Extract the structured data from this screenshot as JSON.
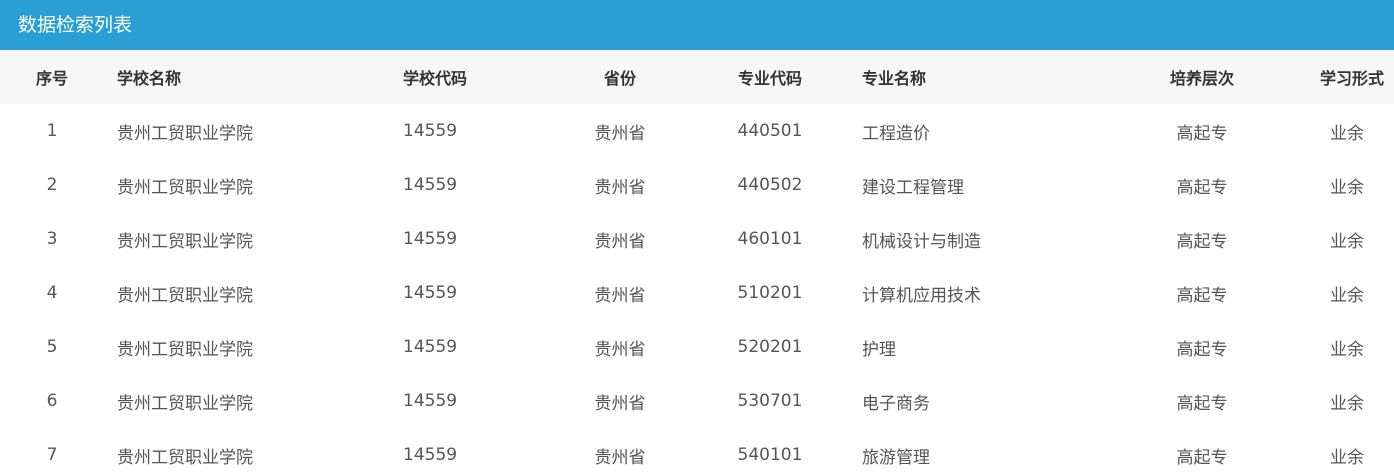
{
  "panel": {
    "title": "数据检索列表"
  },
  "table": {
    "headers": {
      "index": "序号",
      "school_name": "学校名称",
      "school_code": "学校代码",
      "province": "省份",
      "major_code": "专业代码",
      "major_name": "专业名称",
      "level": "培养层次",
      "study_form": "学习形式"
    },
    "rows": [
      {
        "index": "1",
        "school_name": "贵州工贸职业学院",
        "school_code": "14559",
        "province": "贵州省",
        "major_code": "440501",
        "major_name": "工程造价",
        "level": "高起专",
        "study_form": "业余"
      },
      {
        "index": "2",
        "school_name": "贵州工贸职业学院",
        "school_code": "14559",
        "province": "贵州省",
        "major_code": "440502",
        "major_name": "建设工程管理",
        "level": "高起专",
        "study_form": "业余"
      },
      {
        "index": "3",
        "school_name": "贵州工贸职业学院",
        "school_code": "14559",
        "province": "贵州省",
        "major_code": "460101",
        "major_name": "机械设计与制造",
        "level": "高起专",
        "study_form": "业余"
      },
      {
        "index": "4",
        "school_name": "贵州工贸职业学院",
        "school_code": "14559",
        "province": "贵州省",
        "major_code": "510201",
        "major_name": "计算机应用技术",
        "level": "高起专",
        "study_form": "业余"
      },
      {
        "index": "5",
        "school_name": "贵州工贸职业学院",
        "school_code": "14559",
        "province": "贵州省",
        "major_code": "520201",
        "major_name": "护理",
        "level": "高起专",
        "study_form": "业余"
      },
      {
        "index": "6",
        "school_name": "贵州工贸职业学院",
        "school_code": "14559",
        "province": "贵州省",
        "major_code": "530701",
        "major_name": "电子商务",
        "level": "高起专",
        "study_form": "业余"
      },
      {
        "index": "7",
        "school_name": "贵州工贸职业学院",
        "school_code": "14559",
        "province": "贵州省",
        "major_code": "540101",
        "major_name": "旅游管理",
        "level": "高起专",
        "study_form": "业余"
      }
    ]
  },
  "colors": {
    "header_bg": "#2a9fd6",
    "table_head_bg": "#f7f7f7"
  }
}
